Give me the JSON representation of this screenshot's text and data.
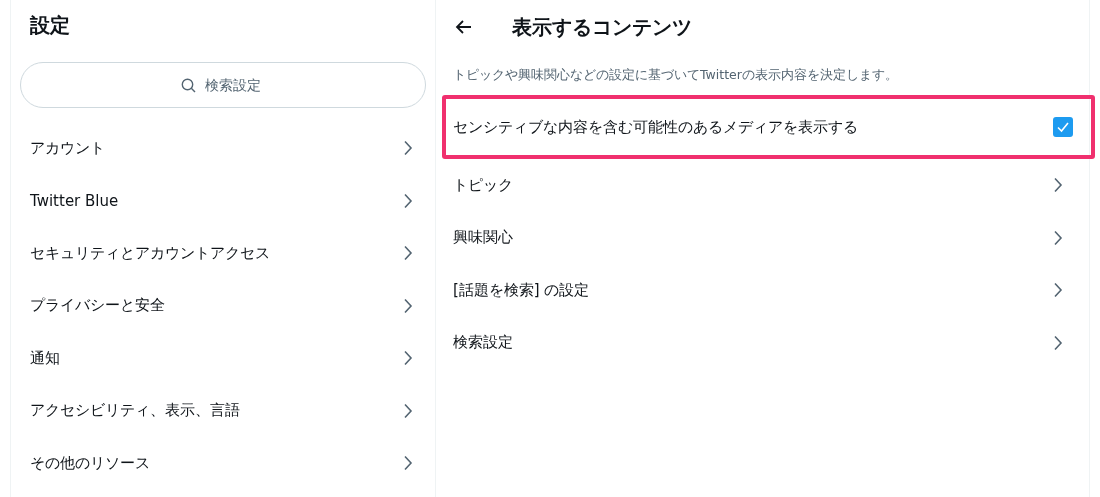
{
  "sidebar": {
    "title": "設定",
    "search": {
      "placeholder": "検索設定"
    },
    "items": [
      {
        "label": "アカウント"
      },
      {
        "label": "Twitter Blue"
      },
      {
        "label": "セキュリティとアカウントアクセス"
      },
      {
        "label": "プライバシーと安全"
      },
      {
        "label": "通知"
      },
      {
        "label": "アクセシビリティ、表示、言語"
      },
      {
        "label": "その他のリソース"
      }
    ]
  },
  "main": {
    "title": "表示するコンテンツ",
    "description": "トピックや興味関心などの設定に基づいてTwitterの表示内容を決定します。",
    "items": [
      {
        "kind": "checkbox",
        "label": "センシティブな内容を含む可能性のあるメディアを表示する",
        "checked": true,
        "highlighted": true
      },
      {
        "kind": "link",
        "label": "トピック"
      },
      {
        "kind": "link",
        "label": "興味関心"
      },
      {
        "kind": "link",
        "label": "[話題を検索] の設定"
      },
      {
        "kind": "link",
        "label": "検索設定"
      }
    ]
  }
}
